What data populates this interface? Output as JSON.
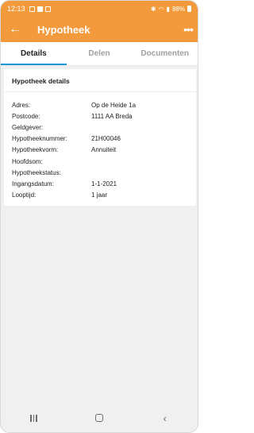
{
  "status_bar": {
    "time": "12:13",
    "battery_text": "88%",
    "icons": [
      "image-icon",
      "app-icon",
      "check-icon",
      "bluetooth-icon",
      "wifi-icon",
      "signal-icon",
      "battery-icon"
    ]
  },
  "app_bar": {
    "title": "Hypotheek",
    "back_icon": "←",
    "more_icon": "•••"
  },
  "tabs": [
    {
      "label": "Details",
      "active": true
    },
    {
      "label": "Delen",
      "active": false
    },
    {
      "label": "Documenten",
      "active": false
    }
  ],
  "card": {
    "title": "Hypotheek details",
    "rows": [
      {
        "label": "Adres:",
        "value": "Op de Heide 1a"
      },
      {
        "label": "Postcode:",
        "value": "1111 AA Breda"
      },
      {
        "label": "Geldgever:",
        "value": ""
      },
      {
        "label": "Hypotheeknummer:",
        "value": "21H00046"
      },
      {
        "label": "Hypotheekvorm:",
        "value": "Annuiteit"
      },
      {
        "label": "Hoofdsom:",
        "value": ""
      },
      {
        "label": "Hypotheekstatus:",
        "value": ""
      },
      {
        "label": "Ingangsdatum:",
        "value": "1-1-2021"
      },
      {
        "label": "Looptijd:",
        "value": "1 jaar"
      }
    ]
  },
  "nav_bar": {
    "back_glyph": "‹"
  },
  "colors": {
    "accent": "#f39a3c",
    "tab_indicator": "#1a9ad7"
  }
}
